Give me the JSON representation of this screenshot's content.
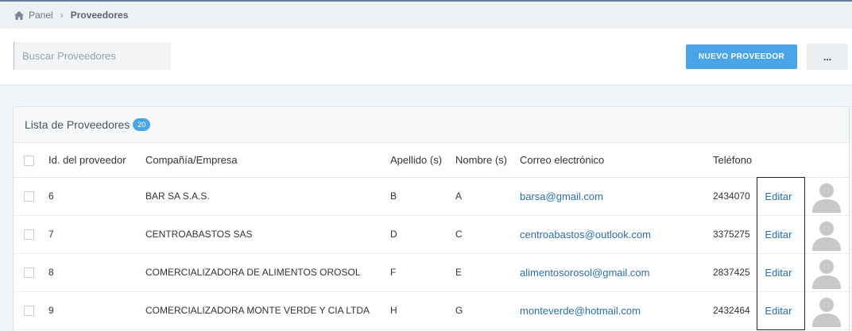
{
  "breadcrumb": {
    "home_icon": "home-icon",
    "home_label": "Panel",
    "current": "Proveedores"
  },
  "toolbar": {
    "search_placeholder": "Buscar Proveedores",
    "new_button": "NUEVO PROVEEDOR",
    "more_button": "..."
  },
  "list": {
    "title": "Lista de Proveedores",
    "count": "20",
    "columns": {
      "id": "Id. del proveedor",
      "company": "Compañía/Empresa",
      "lastname": "Apellido (s)",
      "firstname": "Nombre (s)",
      "email": "Correo electrónico",
      "phone": "Teléfono"
    },
    "rows": [
      {
        "id": "6",
        "company": "BAR SA S.A.S.",
        "lastname": "B",
        "firstname": "A",
        "email": "barsa@gmail.com",
        "phone": "2434070",
        "edit": "Editar"
      },
      {
        "id": "7",
        "company": "CENTROABASTOS SAS",
        "lastname": "D",
        "firstname": "C",
        "email": "centroabastos@outlook.com",
        "phone": "3375275",
        "edit": "Editar"
      },
      {
        "id": "8",
        "company": "COMERCIALIZADORA DE ALIMENTOS OROSOL",
        "lastname": "F",
        "firstname": "E",
        "email": "alimentosorosol@gmail.com",
        "phone": "2837425",
        "edit": "Editar"
      },
      {
        "id": "9",
        "company": "COMERCIALIZADORA MONTE VERDE Y CIA LTDA",
        "lastname": "H",
        "firstname": "G",
        "email": "monteverde@hotmail.com",
        "phone": "2432464",
        "edit": "Editar"
      }
    ]
  },
  "colors": {
    "accent": "#4aa5e8",
    "link": "#2c6fa8"
  }
}
